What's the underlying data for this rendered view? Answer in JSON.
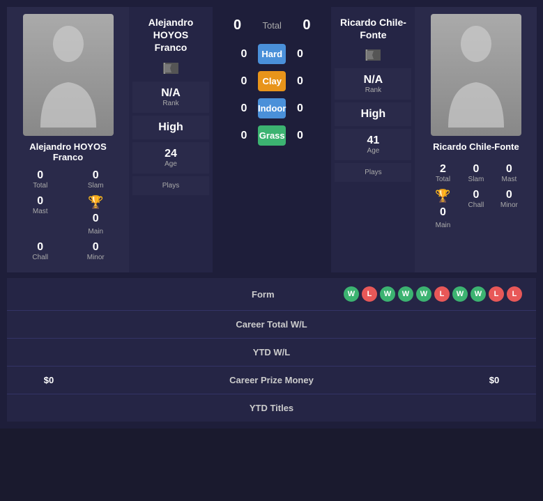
{
  "player1": {
    "name": "Alejandro HOYOS Franco",
    "name_short": "Alejandro HOYOS Franco",
    "total": "0",
    "slam": "0",
    "mast": "0",
    "main": "0",
    "chall": "0",
    "minor": "0",
    "rank_label": "Rank",
    "rank_value": "N/A",
    "high_label": "High",
    "age_value": "24",
    "age_label": "Age",
    "plays_label": "Plays"
  },
  "player2": {
    "name": "Ricardo Chile-Fonte",
    "name_short": "Ricardo Chile-Fonte",
    "total": "2",
    "slam": "0",
    "mast": "0",
    "main": "0",
    "chall": "0",
    "minor": "0",
    "rank_label": "Rank",
    "rank_value": "N/A",
    "high_label": "High",
    "age_value": "41",
    "age_label": "Age",
    "plays_label": "Plays"
  },
  "center": {
    "total_label": "Total",
    "total_left": "0",
    "total_right": "0",
    "courts": [
      {
        "label": "Hard",
        "left": "0",
        "right": "0",
        "type": "hard"
      },
      {
        "label": "Clay",
        "left": "0",
        "right": "0",
        "type": "clay"
      },
      {
        "label": "Indoor",
        "left": "0",
        "right": "0",
        "type": "indoor"
      },
      {
        "label": "Grass",
        "left": "0",
        "right": "0",
        "type": "grass"
      }
    ]
  },
  "bottom": {
    "form_label": "Form",
    "form_badges": [
      "W",
      "L",
      "W",
      "W",
      "W",
      "L",
      "W",
      "W",
      "L",
      "L"
    ],
    "career_wl_label": "Career Total W/L",
    "ytd_wl_label": "YTD W/L",
    "career_prize_label": "Career Prize Money",
    "prize_left": "$0",
    "prize_right": "$0",
    "ytd_titles_label": "YTD Titles"
  }
}
